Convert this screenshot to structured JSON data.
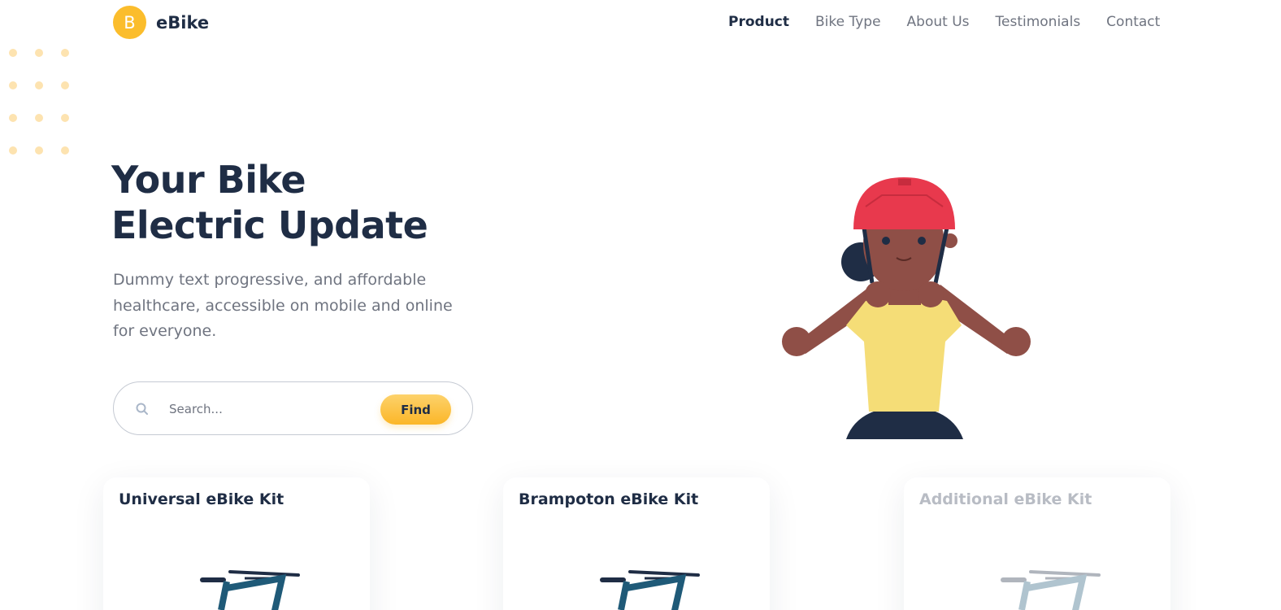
{
  "header": {
    "logo_letter": "B",
    "logo_text": "eBike",
    "nav": [
      {
        "label": "Product",
        "active": true
      },
      {
        "label": "Bike Type",
        "active": false
      },
      {
        "label": "About Us",
        "active": false
      },
      {
        "label": "Testimonials",
        "active": false
      },
      {
        "label": "Contact",
        "active": false
      }
    ]
  },
  "hero": {
    "title_line1": "Your Bike",
    "title_line2": "Electric Update",
    "description": "Dummy text progressive, and affordable healthcare, accessible on mobile and online for everyone.",
    "search_placeholder": "Search...",
    "find_label": "Find"
  },
  "cards": [
    {
      "title": "Universal eBike Kit"
    },
    {
      "title": "Brampoton eBike Kit"
    },
    {
      "title": "Additional eBike Kit"
    }
  ],
  "colors": {
    "accent": "#fbbd2c",
    "dark": "#1f2d45",
    "muted": "#6f7480",
    "helmet": "#e8394d",
    "shirt": "#f5dd77",
    "skin": "#8f4f47"
  },
  "icons": [
    "search-icon",
    "bike-icon",
    "person-helmet-illustration",
    "decorative-dots"
  ]
}
